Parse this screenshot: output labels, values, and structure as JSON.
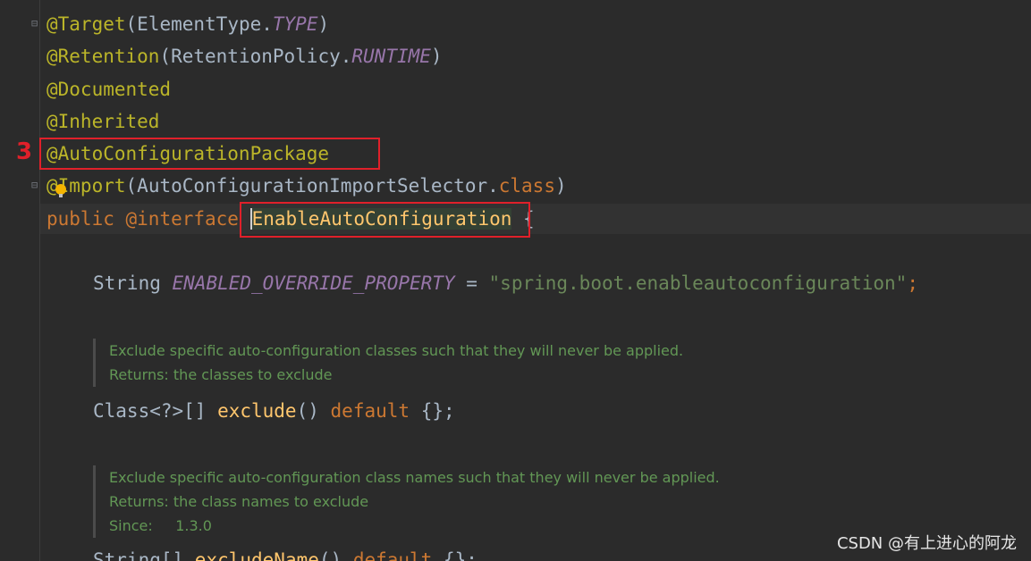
{
  "code": {
    "l1": {
      "ann": "@Target",
      "open": "(",
      "cls": "ElementType.",
      "val": "TYPE",
      "close": ")"
    },
    "l2": {
      "ann": "@Retention",
      "open": "(",
      "cls": "RetentionPolicy.",
      "val": "RUNTIME",
      "close": ")"
    },
    "l3": {
      "ann": "@Documented"
    },
    "l4": {
      "ann": "@Inherited"
    },
    "l5": {
      "ann": "@AutoConfigurationPackage"
    },
    "l6": {
      "ann": "@Import",
      "open": "(",
      "cls": "AutoConfigurationImportSelector.",
      "kw": "class",
      "close": ")"
    },
    "l7": {
      "kw1": "public ",
      "kw2": "@interface ",
      "name": "EnableAutoConfiguration",
      "brace": " {"
    },
    "l8": {
      "type": "String ",
      "const": "ENABLED_OVERRIDE_PROPERTY",
      "eq": " = ",
      "str": "\"spring.boot.enableautoconfiguration\"",
      "semi": ";"
    },
    "doc1": {
      "line1": "Exclude specific auto-configuration classes such that they will never be applied.",
      "line2": "Returns: the classes to exclude"
    },
    "l9": {
      "type": "Class<?>[] ",
      "method": "exclude",
      "parens": "() ",
      "kw": "default",
      "rest": " {};"
    },
    "doc2": {
      "line1": "Exclude specific auto-configuration class names such that they will never be applied.",
      "line2": "Returns: the class names to exclude",
      "line3": "Since:     1.3.0"
    },
    "l10": {
      "type": "String[] ",
      "method": "excludeName",
      "parens": "() ",
      "kw": "default",
      "rest": " {};"
    }
  },
  "annotation_marker": "3",
  "watermark": "CSDN @有上进心的阿龙"
}
